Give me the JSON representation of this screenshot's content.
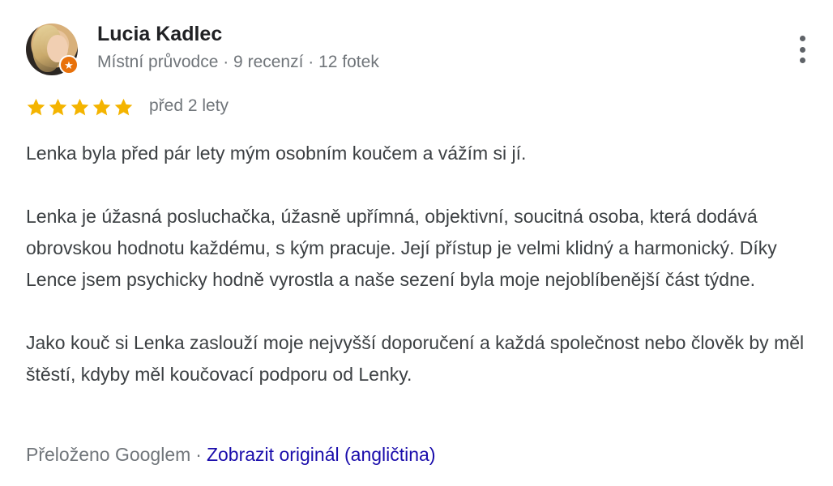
{
  "reviewer": {
    "name": "Lucia Kadlec",
    "meta": "Místní průvodce · 9 recenzí · 12 fotek",
    "badge_icon": "local-guide-star-icon",
    "badge_color": "#e8710a"
  },
  "rating": {
    "stars": 5,
    "max": 5,
    "star_color": "#f4b400"
  },
  "date": "před 2 lety",
  "review": {
    "paragraphs": [
      "Lenka byla před pár lety mým osobním koučem a vážím si jí.",
      "Lenka je úžasná posluchačka, úžasně upřímná, objektivní, soucitná osoba, která dodává obrovskou hodnotu každému, s kým pracuje. Její přístup je velmi klidný a harmonický. Díky Lence jsem psychicky hodně vyrostla a naše sezení byla moje nejoblíbenější část týdne.",
      "Jako kouč si Lenka zaslouží moje nejvyšší doporučení a každá společnost nebo člověk by měl štěstí, kdyby měl koučovací podporu od Lenky."
    ]
  },
  "translation": {
    "note": "Přeloženo Googlem",
    "separator": "·",
    "link": "Zobrazit originál (angličtina)",
    "link_color": "#1a0dab"
  },
  "menu": {
    "icon": "more-vert-icon"
  }
}
